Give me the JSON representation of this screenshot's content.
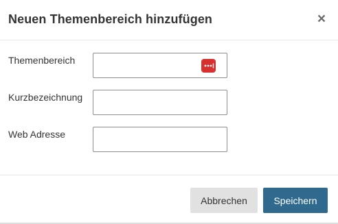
{
  "dialog": {
    "title": "Neuen Themenbereich hinzufügen",
    "close_symbol": "×"
  },
  "form": {
    "fields": [
      {
        "label": "Themenbereich",
        "value": "",
        "icon": "password-manager-icon"
      },
      {
        "label": "Kurzbezeichnung",
        "value": ""
      },
      {
        "label": "Web Adresse",
        "value": ""
      }
    ]
  },
  "footer": {
    "cancel_label": "Abbrechen",
    "save_label": "Speichern"
  },
  "colors": {
    "primary": "#2f6a8e",
    "secondary_button": "#e1e1e1",
    "icon_red": "#d7302e"
  }
}
